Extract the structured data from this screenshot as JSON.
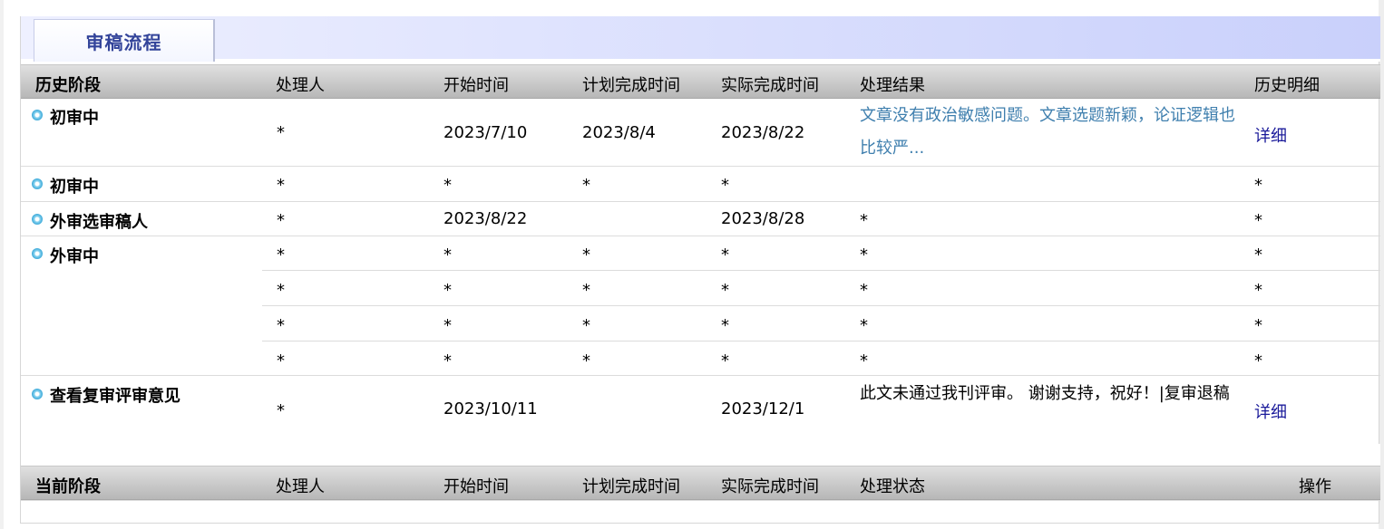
{
  "tab": {
    "title": "审稿流程"
  },
  "history_header": {
    "stage": "历史阶段",
    "handler": "处理人",
    "start": "开始时间",
    "planned": "计划完成时间",
    "actual": "实际完成时间",
    "result": "处理结果",
    "detail": "历史明细"
  },
  "history_rows": [
    {
      "stage": "初审中",
      "handler": "*",
      "start": "2023/7/10",
      "planned": "2023/8/4",
      "actual": "2023/8/22",
      "result": "文章没有政治敏感问题。文章选题新颖，论证逻辑也比较严...",
      "detail": "详细"
    },
    {
      "stage": "初审中",
      "handler": "*",
      "start": "*",
      "planned": "*",
      "actual": "*",
      "result": "",
      "detail": "*"
    },
    {
      "stage": "外审选审稿人",
      "handler": "*",
      "start": "2023/8/22",
      "planned": "",
      "actual": "2023/8/28",
      "result": "*",
      "detail": "*"
    },
    {
      "stage": "外审中",
      "subrows": [
        {
          "handler": "*",
          "start": "*",
          "planned": "*",
          "actual": "*",
          "result": "*",
          "detail": "*"
        },
        {
          "handler": "*",
          "start": "*",
          "planned": "*",
          "actual": "*",
          "result": "*",
          "detail": "*"
        },
        {
          "handler": "*",
          "start": "*",
          "planned": "*",
          "actual": "*",
          "result": "*",
          "detail": "*"
        },
        {
          "handler": "*",
          "start": "*",
          "planned": "*",
          "actual": "*",
          "result": "*",
          "detail": "*"
        }
      ]
    },
    {
      "stage": "查看复审评审意见",
      "handler": "*",
      "start": "2023/10/11",
      "planned": "",
      "actual": "2023/12/1",
      "result": "此文未通过我刊评审。 谢谢支持，祝好！|复审退稿",
      "detail": "详细"
    }
  ],
  "current_header": {
    "stage": "当前阶段",
    "handler": "处理人",
    "start": "开始时间",
    "planned": "计划完成时间",
    "actual": "实际完成时间",
    "status": "处理状态",
    "action": "操作"
  },
  "colors": {
    "tab_text": "#33449a",
    "link": "#1a1a9a",
    "result_link": "#3f7fae",
    "header_bg": "#c4c4c4"
  },
  "icons": {
    "stage_bullet": "circle-bullet-icon"
  }
}
